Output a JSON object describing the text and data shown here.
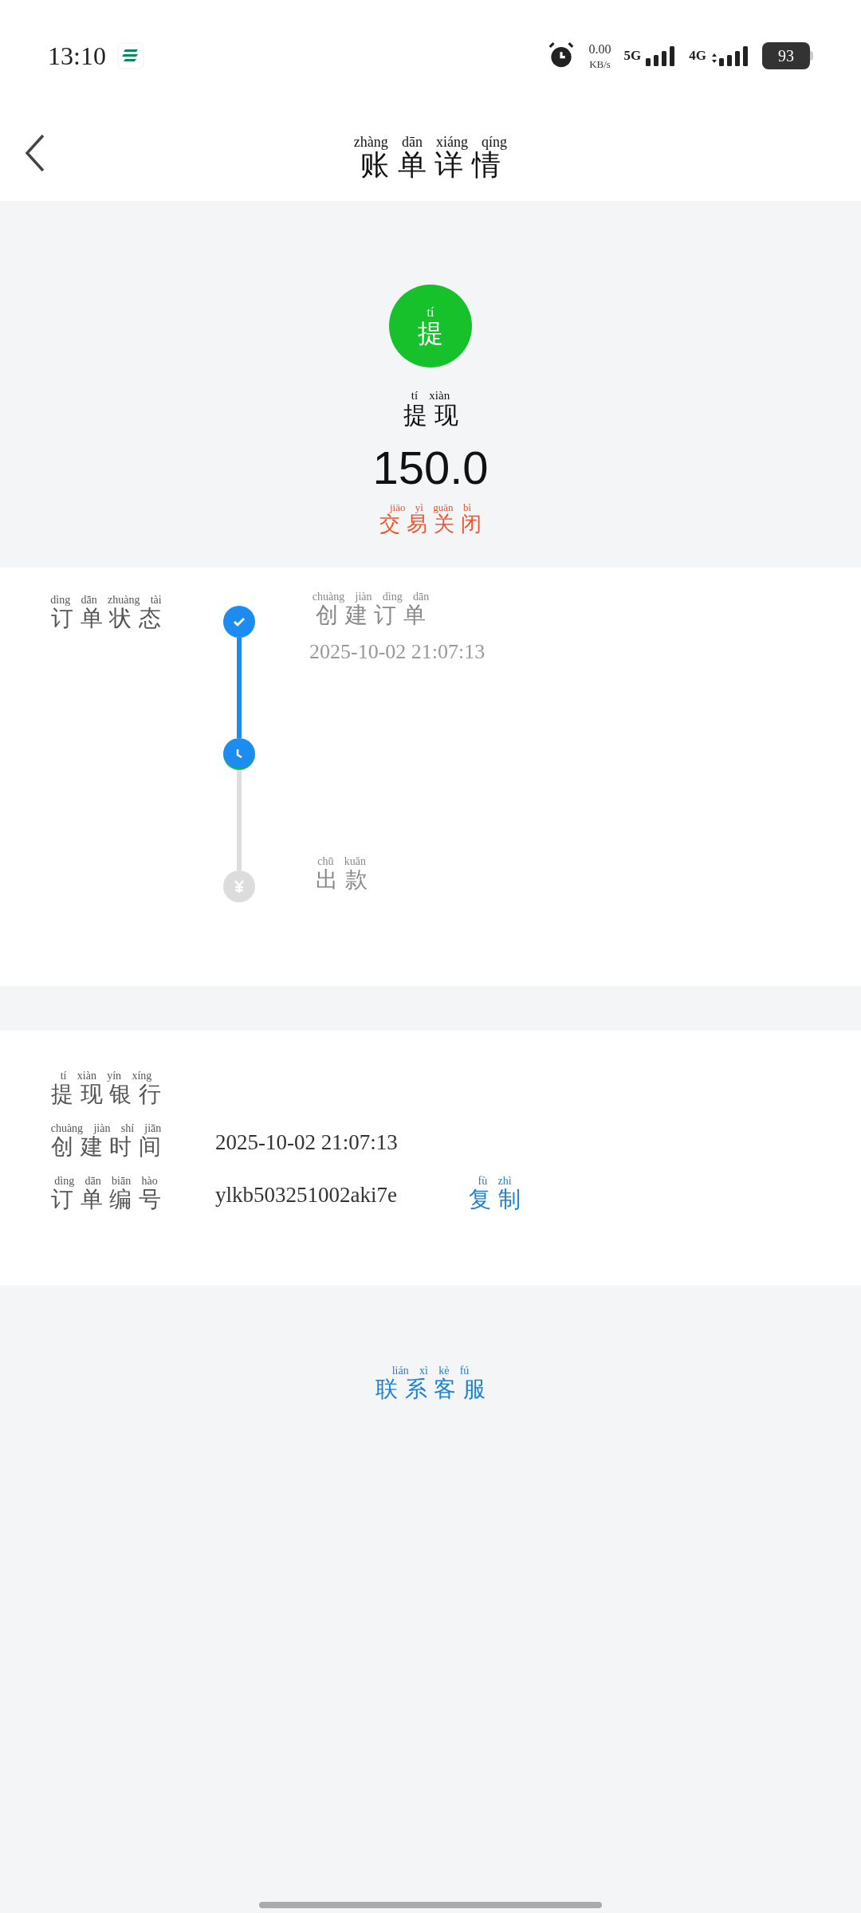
{
  "status_bar": {
    "time": "13:10",
    "speed_value": "0.00",
    "speed_unit": "KB/s",
    "network_1": "5G",
    "network_2": "4G",
    "battery": "93"
  },
  "header": {
    "title": {
      "hanzi": "账单详情",
      "pinyin": "zhàng dān xiáng qíng"
    }
  },
  "summary": {
    "badge": {
      "hanzi": "提",
      "pinyin": "tí"
    },
    "type": {
      "hanzi": "提现",
      "pinyin": "tí xiàn"
    },
    "amount": "150.0",
    "status": {
      "hanzi": "交易关闭",
      "pinyin": "jiāo yì guān bì"
    }
  },
  "order_status": {
    "label": {
      "hanzi": "订单状态",
      "pinyin": "dìng dān zhuàng tài"
    },
    "steps": [
      {
        "kind": "done",
        "title": {
          "hanzi": "创建订单",
          "pinyin": "chuàng jiàn dìng dān"
        },
        "time": "2025-10-02 21:07:13"
      },
      {
        "kind": "current"
      },
      {
        "kind": "pending",
        "title": {
          "hanzi": "出款",
          "pinyin": "chū kuǎn"
        }
      }
    ]
  },
  "details": [
    {
      "label": {
        "hanzi": "提现银行",
        "pinyin": "tí xiàn yín xíng"
      }
    },
    {
      "label": {
        "hanzi": "创建时间",
        "pinyin": "chuàng jiàn shí jiān"
      },
      "value": "2025-10-02 21:07:13"
    },
    {
      "label": {
        "hanzi": "订单编号",
        "pinyin": "dìng dān biān hào"
      },
      "value": "ylkb503251002aki7e",
      "action": {
        "hanzi": "复制",
        "pinyin": "fù zhì"
      }
    }
  ],
  "contact": {
    "hanzi": "联系客服",
    "pinyin": "lián xì kè fú"
  }
}
